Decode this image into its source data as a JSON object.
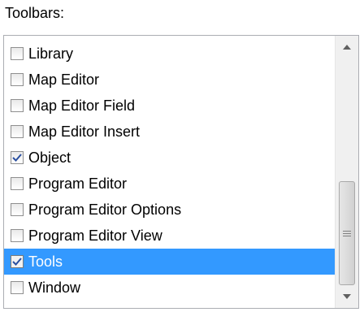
{
  "header": {
    "label": "Toolbars:"
  },
  "toolbars": {
    "items": [
      {
        "label": "Library",
        "checked": false,
        "selected": false
      },
      {
        "label": "Map Editor",
        "checked": false,
        "selected": false
      },
      {
        "label": "Map Editor Field",
        "checked": false,
        "selected": false
      },
      {
        "label": "Map Editor Insert",
        "checked": false,
        "selected": false
      },
      {
        "label": "Object",
        "checked": true,
        "selected": false
      },
      {
        "label": "Program Editor",
        "checked": false,
        "selected": false
      },
      {
        "label": "Program Editor Options",
        "checked": false,
        "selected": false
      },
      {
        "label": "Program Editor View",
        "checked": false,
        "selected": false
      },
      {
        "label": "Tools",
        "checked": true,
        "selected": true
      },
      {
        "label": "Window",
        "checked": false,
        "selected": false
      }
    ]
  },
  "scrollbar": {
    "up_icon": "arrow-up-icon",
    "down_icon": "arrow-down-icon",
    "grip_icon": "grip-icon"
  }
}
